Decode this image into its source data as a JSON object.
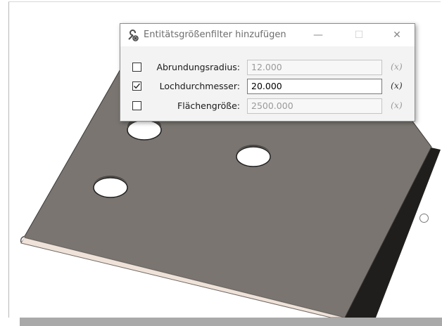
{
  "dialog": {
    "title": "Entitätsgrößenfilter hinzufügen",
    "title_icon": "wrench-gear-icon",
    "minimize_glyph": "—",
    "maximize_glyph": "☐",
    "close_glyph": "✕",
    "rows": [
      {
        "label": "Abrundungsradius:",
        "value": "12.000",
        "checked": false,
        "enabled": false,
        "var_label": "(x)"
      },
      {
        "label": "Lochdurchmesser:",
        "value": "20.000",
        "checked": true,
        "enabled": true,
        "var_label": "(x)"
      },
      {
        "label": "Flächengröße:",
        "value": "2500.000",
        "checked": false,
        "enabled": false,
        "var_label": "(x)"
      }
    ]
  },
  "colors": {
    "plate_top": "#797470",
    "plate_edge": "#f4e6dc",
    "plate_side": "#2c2a28",
    "hole_fill": "#ffffff"
  }
}
